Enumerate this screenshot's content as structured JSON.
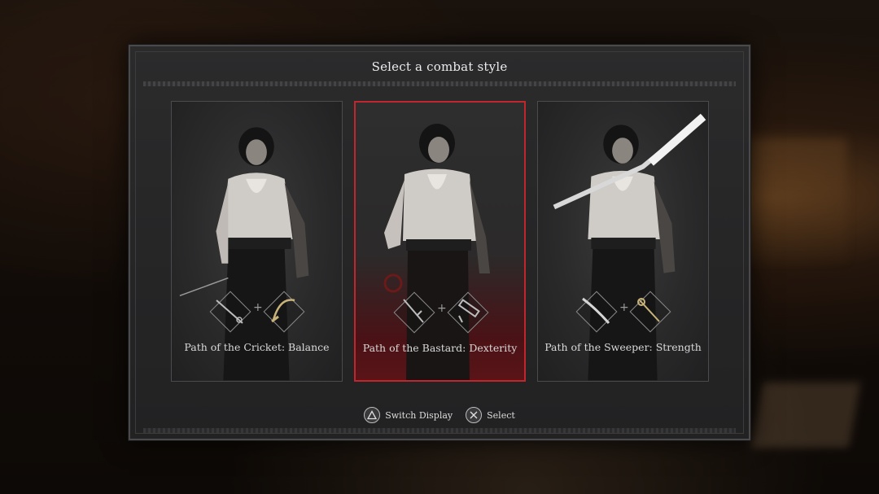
{
  "dialog": {
    "title": "Select a combat style"
  },
  "styles": [
    {
      "label": "Path of the Cricket: Balance",
      "weapons": [
        "rapier-icon",
        "sabre-icon"
      ],
      "selected": false
    },
    {
      "label": "Path of the Bastard: Dexterity",
      "weapons": [
        "dagger-icon",
        "hand-cannon-icon"
      ],
      "selected": true
    },
    {
      "label": "Path of the Sweeper: Strength",
      "weapons": [
        "greatsword-icon",
        "mace-icon"
      ],
      "selected": false
    }
  ],
  "footer": {
    "switch_display": "Switch Display",
    "select": "Select",
    "switch_icon": "triangle-button-icon",
    "select_icon": "cross-button-icon"
  },
  "colors": {
    "selected_border": "#c0262e",
    "panel": "#2b2b2c",
    "text": "#ececec"
  }
}
